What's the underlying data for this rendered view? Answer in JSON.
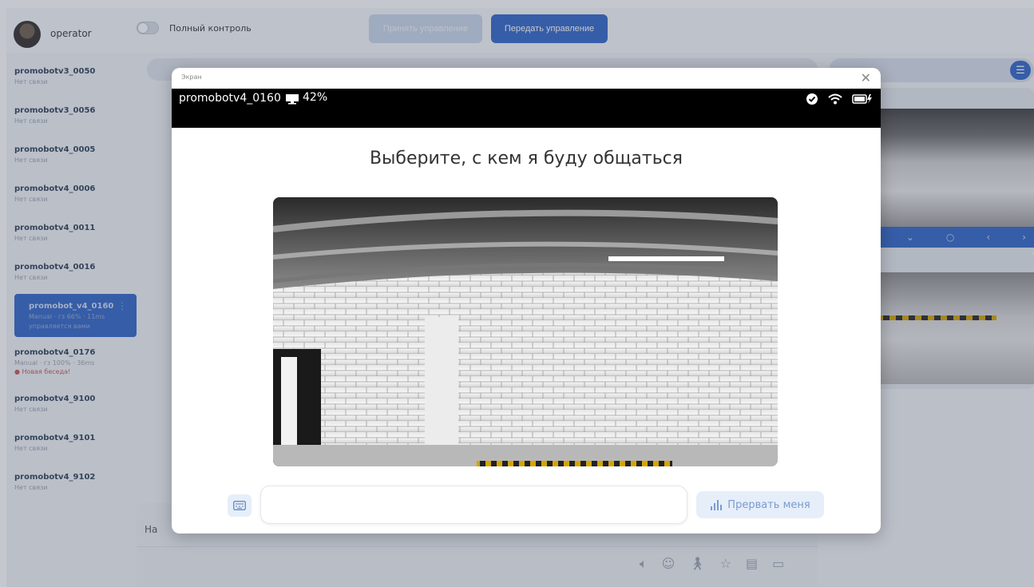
{
  "topbar": {
    "operator_name": "operator",
    "full_control_label": "Полный контроль",
    "accept_control_label": "Принять управление",
    "pass_control_label": "Передать управление"
  },
  "sidebar": {
    "robots": [
      {
        "name": "promobotv3_0050",
        "status": "Нет связи"
      },
      {
        "name": "promobotv3_0056",
        "status": "Нет связи"
      },
      {
        "name": "promobotv4_0005",
        "status": "Нет связи"
      },
      {
        "name": "promobotv4_0006",
        "status": "Нет связи"
      },
      {
        "name": "promobotv4_0011",
        "status": "Нет связи"
      },
      {
        "name": "promobotv4_0016",
        "status": "Нет связи"
      },
      {
        "name": "promobot_v4_0160",
        "status": "Manual · гз 66% · 11ms",
        "status2": "управляется вами"
      },
      {
        "name": "promobotv4_0176",
        "status": "Manual · гз 100% · 36ms",
        "note": "Новая беседа!"
      },
      {
        "name": "promobotv4_9100",
        "status": "Нет связи"
      },
      {
        "name": "promobotv4_9101",
        "status": "Нет связи"
      },
      {
        "name": "promobotv4_9102",
        "status": "Нет связи"
      }
    ]
  },
  "center": {
    "input_hint": "На"
  },
  "modal": {
    "title": "Экран",
    "robot_id": "promobotv4_0160",
    "battery_percent": "42%",
    "heading": "Выберите, с кем я буду общаться",
    "input_placeholder": "",
    "interrupt_label": "Прервать меня"
  },
  "icons": {
    "close": "close-icon",
    "monitor": "monitor-icon",
    "check": "check-circle-icon",
    "wifi": "wifi-icon",
    "battery": "battery-charging-icon",
    "keyboard": "keyboard-icon",
    "voice": "voice-bars-icon"
  },
  "colors": {
    "accent": "#2f63c8",
    "overlay": "#46506452"
  }
}
